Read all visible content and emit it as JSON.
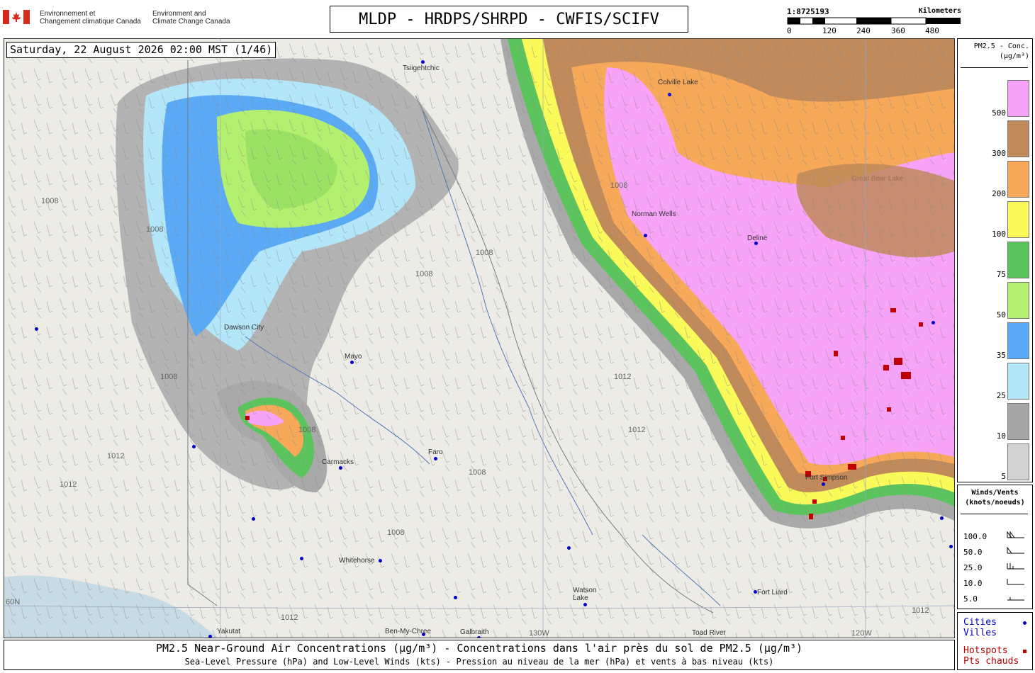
{
  "header": {
    "dept_fr_line1": "Environnement et",
    "dept_fr_line2": "Changement climatique Canada",
    "dept_en_line1": "Environment and",
    "dept_en_line2": "Climate Change Canada",
    "title": "MLDP - HRDPS/SHRPD - CWFIS/SCIFV",
    "scale_ratio": "1:8725193",
    "scale_unit": "Kilometers",
    "scale_ticks": [
      "0",
      "120",
      "240",
      "360",
      "480"
    ]
  },
  "map": {
    "timestamp": "Saturday, 22 August 2026 02:00 MST (1/46)",
    "cities": [
      {
        "name": "Tsiigehtchic"
      },
      {
        "name": "Colville Lake"
      },
      {
        "name": "Norman Wells"
      },
      {
        "name": "Deline"
      },
      {
        "name": "Dawson City"
      },
      {
        "name": "Mayo"
      },
      {
        "name": "Carmacks"
      },
      {
        "name": "Faro"
      },
      {
        "name": "Fort Simpson"
      },
      {
        "name": "Whitehorse"
      },
      {
        "name": "Watson Lake"
      },
      {
        "name": "Fort Liard"
      },
      {
        "name": "Yakutat"
      },
      {
        "name": "Ben-My-Chree"
      },
      {
        "name": "Galbraith"
      },
      {
        "name": "Toad River"
      },
      {
        "name": "Great Bear Lake"
      }
    ],
    "isobar_labels": [
      "1008",
      "1012"
    ],
    "grid_labels": [
      "60N",
      "130W",
      "120W"
    ]
  },
  "pm_legend": {
    "title_line1": "PM2.5 - Conc.",
    "title_line2": "(µg/m³)",
    "levels": [
      {
        "label": "500",
        "color": "#f7a3f7"
      },
      {
        "label": "300",
        "color": "#c08a5a"
      },
      {
        "label": "200",
        "color": "#f7a858"
      },
      {
        "label": "100",
        "color": "#fafa5a"
      },
      {
        "label": "75",
        "color": "#5cc45c"
      },
      {
        "label": "50",
        "color": "#b4f070"
      },
      {
        "label": "35",
        "color": "#5aaaf5"
      },
      {
        "label": "25",
        "color": "#b4e6fa"
      },
      {
        "label": "10",
        "color": "#a6a6a6"
      },
      {
        "label": "5",
        "color": "#d2d2d2"
      }
    ]
  },
  "wind_legend": {
    "title_line1": "Winds/Vents",
    "title_line2": "(knots/noeuds)",
    "speeds": [
      "100.0",
      "50.0",
      "25.0",
      "10.0",
      "5.0"
    ]
  },
  "cities_legend": {
    "cities_en": "Cities",
    "cities_fr": "Villes",
    "hotspots_en": "Hotspots",
    "hotspots_fr": "Pts chauds",
    "city_color": "#0000cc",
    "hotspot_color": "#c00000"
  },
  "footer": {
    "line1": "PM2.5 Near-Ground Air Concentrations (µg/m³) - Concentrations dans l'air près du sol de PM2.5 (µg/m³)",
    "line2": "Sea-Level Pressure (hPa) and Low-Level Winds (kts) - Pression au niveau de la mer (hPa) et vents à bas niveau (kts)"
  }
}
